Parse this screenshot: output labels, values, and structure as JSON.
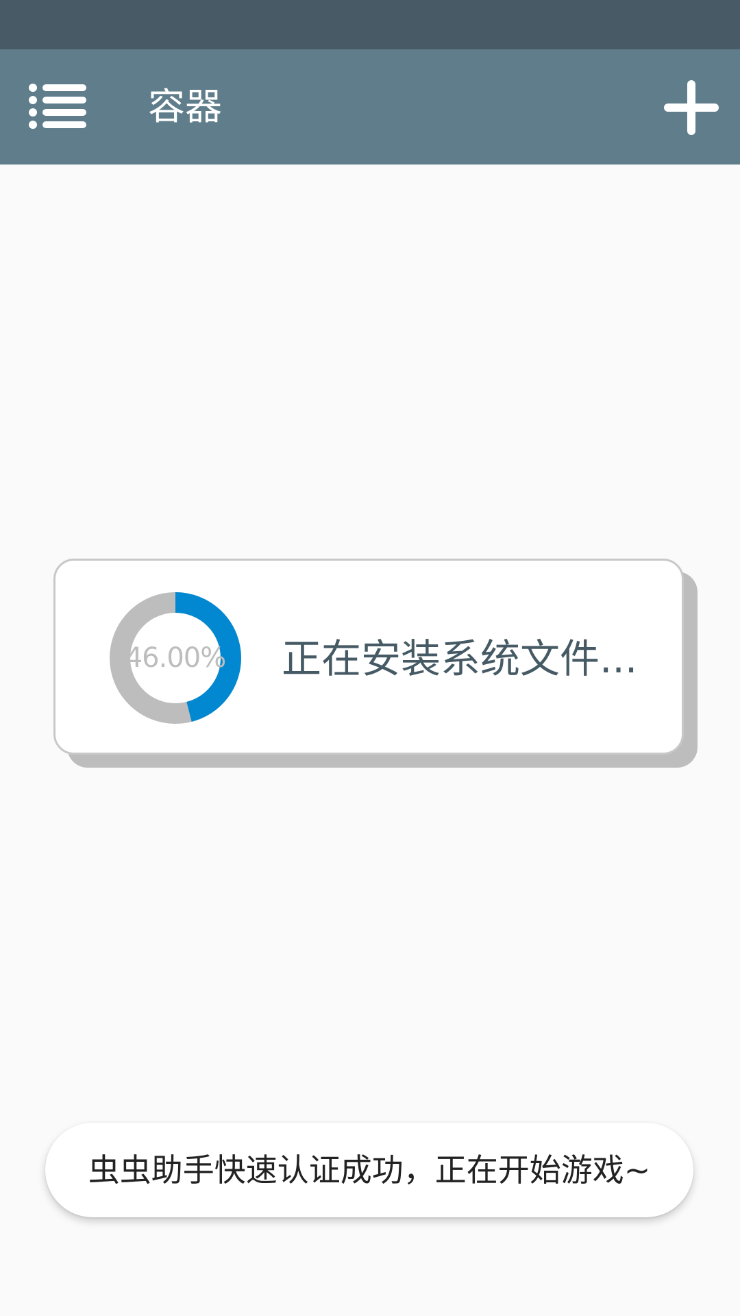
{
  "colors": {
    "status_bar": "#475a66",
    "app_bar": "#607d8b",
    "progress_fill": "#0288d1",
    "progress_track": "#bdbdbd",
    "message_text": "#455a64"
  },
  "app_bar": {
    "title": "容器",
    "menu_icon": "menu-list-icon",
    "add_icon": "plus-icon"
  },
  "dialog": {
    "progress_value": 0.46,
    "progress_label": "46.00%",
    "message": "正在安装系统文件..."
  },
  "toast": {
    "text": "虫虫助手快速认证成功，正在开始游戏~"
  }
}
